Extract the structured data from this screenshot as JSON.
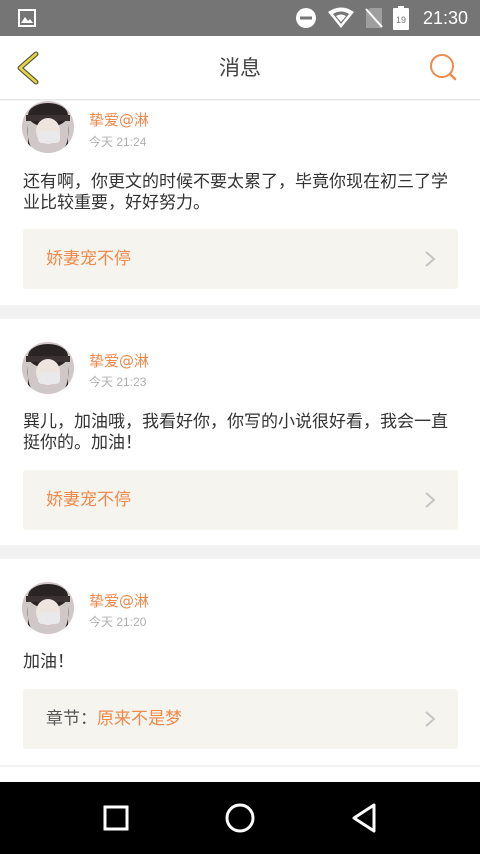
{
  "status_bar": {
    "time": "21:30",
    "icons": [
      "image-icon",
      "do-not-disturb-icon",
      "wifi-icon",
      "no-sim-icon",
      "battery-icon"
    ],
    "battery_level": "19"
  },
  "header": {
    "title": "消息",
    "back_icon": "chevron-left-icon",
    "search_icon": "search-icon",
    "accent_color": "#f08a4b"
  },
  "messages": [
    {
      "username": "挚爱@淋",
      "time": "今天 21:24",
      "content": "还有啊，你更文的时候不要太累了，毕竟你现在初三了学业比较重要，好好努力。",
      "link_prefix": "",
      "link_text": "娇妻宠不停"
    },
    {
      "username": "挚爱@淋",
      "time": "今天 21:23",
      "content": "巽儿，加油哦，我看好你，你写的小说很好看，我会一直挺你的。加油！",
      "link_prefix": "",
      "link_text": "娇妻宠不停"
    },
    {
      "username": "挚爱@淋",
      "time": "今天 21:20",
      "content": "加油！",
      "link_prefix": "章节：",
      "link_text": "原来不是梦"
    }
  ],
  "nav_bar": {
    "recents_icon": "square-icon",
    "home_icon": "circle-icon",
    "back_icon": "triangle-back-icon"
  }
}
